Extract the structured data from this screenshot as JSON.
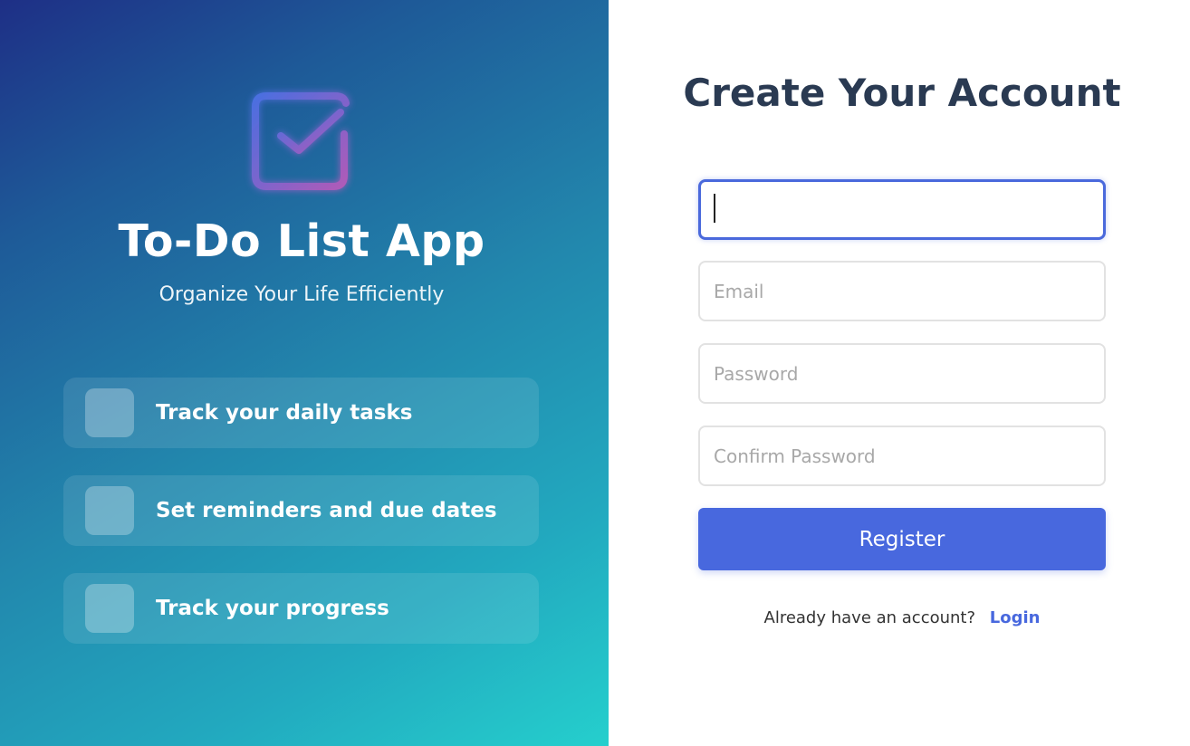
{
  "brand": {
    "title": "To-Do List App",
    "subtitle": "Organize Your Life Efficiently",
    "logo_icon": "checkbox-check-icon",
    "logo_colors": [
      "#4a6fe0",
      "#b05ab8"
    ]
  },
  "features": [
    {
      "label": "Track your daily tasks"
    },
    {
      "label": "Set reminders and due dates"
    },
    {
      "label": "Track your progress"
    }
  ],
  "form": {
    "title": "Create Your Account",
    "name_value": "",
    "email_placeholder": "Email",
    "password_placeholder": "Password",
    "confirm_placeholder": "Confirm Password",
    "register_label": "Register",
    "login_prompt": "Already have an account?",
    "login_link": "Login"
  },
  "colors": {
    "accent": "#4868de",
    "heading": "#2a3a52"
  }
}
